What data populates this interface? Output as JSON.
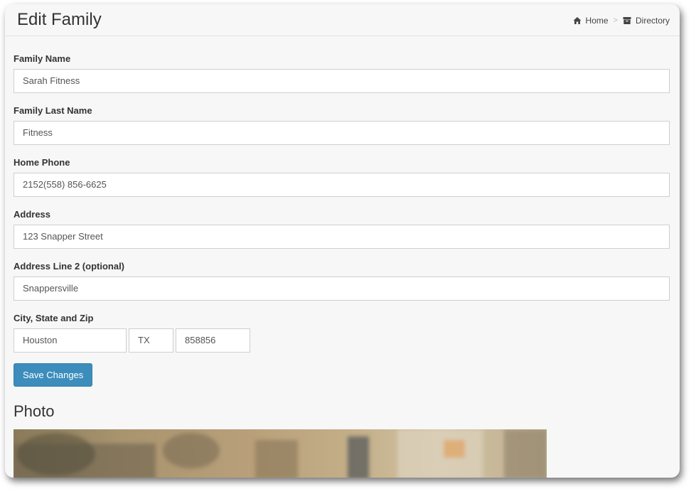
{
  "header": {
    "title": "Edit Family",
    "breadcrumb": [
      {
        "label": "Home",
        "icon": "home-icon"
      },
      {
        "label": "Directory",
        "icon": "archive-icon"
      }
    ],
    "separator": ">"
  },
  "form": {
    "family_name": {
      "label": "Family Name",
      "value": "Sarah Fitness"
    },
    "family_last_name": {
      "label": "Family Last Name",
      "value": "Fitness"
    },
    "home_phone": {
      "label": "Home Phone",
      "value": "2152(558) 856-6625"
    },
    "address": {
      "label": "Address",
      "value": "123 Snapper Street"
    },
    "address2": {
      "label": "Address Line 2 (optional)",
      "value": "Snappersville"
    },
    "city_state_zip": {
      "label": "City, State and Zip",
      "city": "Houston",
      "state": "TX",
      "zip": "858856"
    },
    "save_label": "Save Changes"
  },
  "photo": {
    "title": "Photo"
  },
  "colors": {
    "accent": "#3c8dbc",
    "background": "#f7f7f7"
  }
}
